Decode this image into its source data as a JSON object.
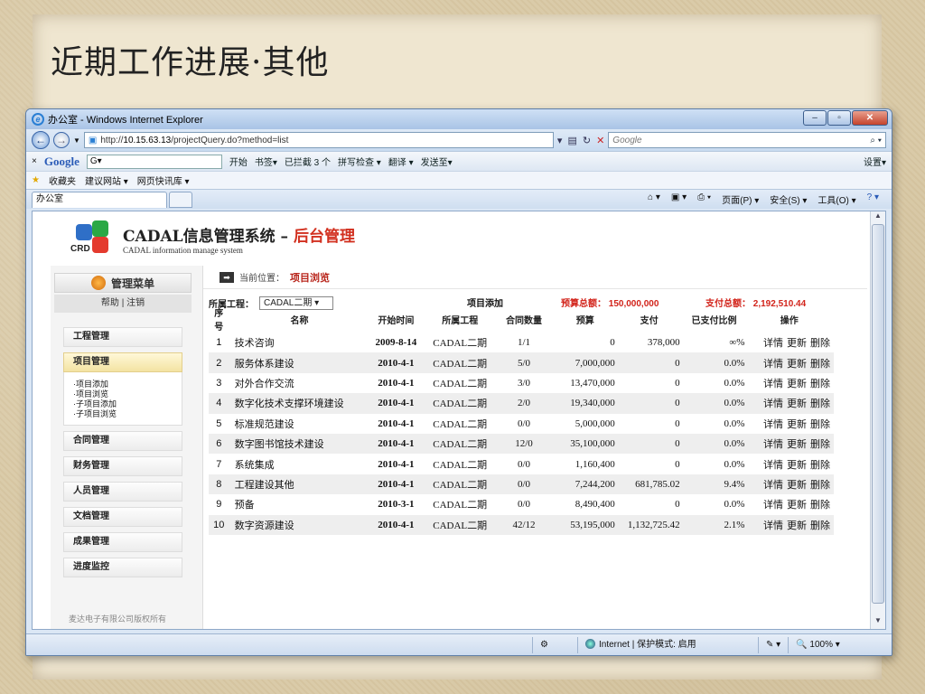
{
  "slide": {
    "title": "近期工作进展·其他"
  },
  "browser": {
    "window_title": "办公室 - Windows Internet Explorer",
    "url_prefix": "http://",
    "url_host": "10.15.63.13",
    "url_path": "/projectQuery.do?method=list",
    "search_placeholder": "Google",
    "google_toolbar": {
      "logo": "Google",
      "search_value": "G▾",
      "items": [
        "开始",
        "书签▾",
        "已拦截 3 个",
        "拼写检查 ▾",
        "翻译 ▾",
        "发送至▾"
      ],
      "settings": "设置▾"
    },
    "favorites": {
      "label": "收藏夹",
      "items": [
        "建议网站 ▾",
        "网页快讯库 ▾"
      ]
    },
    "tab_label": "办公室",
    "commands": [
      "页面(P) ▾",
      "安全(S) ▾",
      "工具(O) ▾"
    ],
    "status": {
      "zone": "Internet | 保护模式: 启用",
      "zoom": "100%"
    }
  },
  "app": {
    "title_main": "CADAL信息管理系统",
    "title_dash": " – ",
    "title_admin": "后台管理",
    "subtitle": "CADAL information manage system",
    "logo_text": "CRD",
    "menu_title": "管理菜单",
    "help_label": "帮助",
    "logout_label": "注销",
    "menu": [
      "工程管理",
      "项目管理",
      "合同管理",
      "财务管理",
      "人员管理",
      "文档管理",
      "成果管理",
      "进度监控"
    ],
    "submenu": [
      "·项目添加",
      "·项目浏览",
      "·子项目添加",
      "·子项目浏览"
    ],
    "footer": "麦达电子有限公司版权所有"
  },
  "content": {
    "crumb_label": "当前位置：",
    "crumb_current": "项目浏览",
    "filter_label": "所属工程：",
    "filter_value": "CADAL二期 ▾",
    "add_label": "项目添加",
    "budget_total": "预算总额： 150,000,000",
    "pay_total": "支付总额： 2,192,510.44",
    "columns": [
      "序号",
      "名称",
      "开始时间",
      "所属工程",
      "合同数量",
      "预算",
      "支付",
      "已支付比例",
      "操作"
    ],
    "op_labels": [
      "详情",
      "更新",
      "删除"
    ],
    "rows": [
      {
        "no": "1",
        "name": "技术咨询",
        "date": "2009-8-14",
        "project": "CADAL二期",
        "count": "1/1",
        "budget": "0",
        "paid": "378,000",
        "ratio": "∞%"
      },
      {
        "no": "2",
        "name": "服务体系建设",
        "date": "2010-4-1",
        "project": "CADAL二期",
        "count": "5/0",
        "budget": "7,000,000",
        "paid": "0",
        "ratio": "0.0%"
      },
      {
        "no": "3",
        "name": "对外合作交流",
        "date": "2010-4-1",
        "project": "CADAL二期",
        "count": "3/0",
        "budget": "13,470,000",
        "paid": "0",
        "ratio": "0.0%"
      },
      {
        "no": "4",
        "name": "数字化技术支撑环境建设",
        "date": "2010-4-1",
        "project": "CADAL二期",
        "count": "2/0",
        "budget": "19,340,000",
        "paid": "0",
        "ratio": "0.0%"
      },
      {
        "no": "5",
        "name": "标准规范建设",
        "date": "2010-4-1",
        "project": "CADAL二期",
        "count": "0/0",
        "budget": "5,000,000",
        "paid": "0",
        "ratio": "0.0%"
      },
      {
        "no": "6",
        "name": "数字图书馆技术建设",
        "date": "2010-4-1",
        "project": "CADAL二期",
        "count": "12/0",
        "budget": "35,100,000",
        "paid": "0",
        "ratio": "0.0%"
      },
      {
        "no": "7",
        "name": "系统集成",
        "date": "2010-4-1",
        "project": "CADAL二期",
        "count": "0/0",
        "budget": "1,160,400",
        "paid": "0",
        "ratio": "0.0%"
      },
      {
        "no": "8",
        "name": "工程建设其他",
        "date": "2010-4-1",
        "project": "CADAL二期",
        "count": "0/0",
        "budget": "7,244,200",
        "paid": "681,785.02",
        "ratio": "9.4%"
      },
      {
        "no": "9",
        "name": "预备",
        "date": "2010-3-1",
        "project": "CADAL二期",
        "count": "0/0",
        "budget": "8,490,400",
        "paid": "0",
        "ratio": "0.0%"
      },
      {
        "no": "10",
        "name": "数字资源建设",
        "date": "2010-4-1",
        "project": "CADAL二期",
        "count": "42/12",
        "budget": "53,195,000",
        "paid": "1,132,725.42",
        "ratio": "2.1%"
      }
    ]
  }
}
